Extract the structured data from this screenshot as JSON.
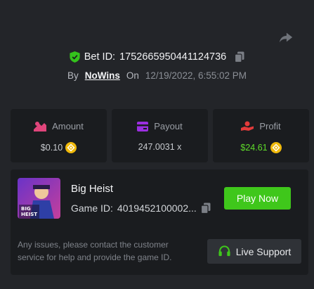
{
  "header": {
    "share_icon": "share-icon",
    "bet_id_label": "Bet ID:",
    "bet_id": "1752665950441124736",
    "by_label": "By",
    "username": "NoWins",
    "on_label": "On",
    "timestamp": "12/19/2022, 6:55:02 PM"
  },
  "stats": {
    "amount": {
      "label": "Amount",
      "value": "$0.10",
      "icon": "amount-icon"
    },
    "payout": {
      "label": "Payout",
      "value": "247.0031 x",
      "icon": "wallet-icon"
    },
    "profit": {
      "label": "Profit",
      "value": "$24.61",
      "icon": "profit-icon"
    }
  },
  "game": {
    "thumb_text_line1": "BIG",
    "thumb_text_line2": "HEIST",
    "name": "Big Heist",
    "game_id_label": "Game ID:",
    "game_id": "4019452100002...",
    "play_label": "Play Now",
    "note": "Any issues, please contact the customer service for help and provide the game ID.",
    "support_label": "Live Support"
  },
  "colors": {
    "accent_green": "#3fc71b",
    "profit_green": "#5fdc2a",
    "shield_green": "#34c21c"
  }
}
